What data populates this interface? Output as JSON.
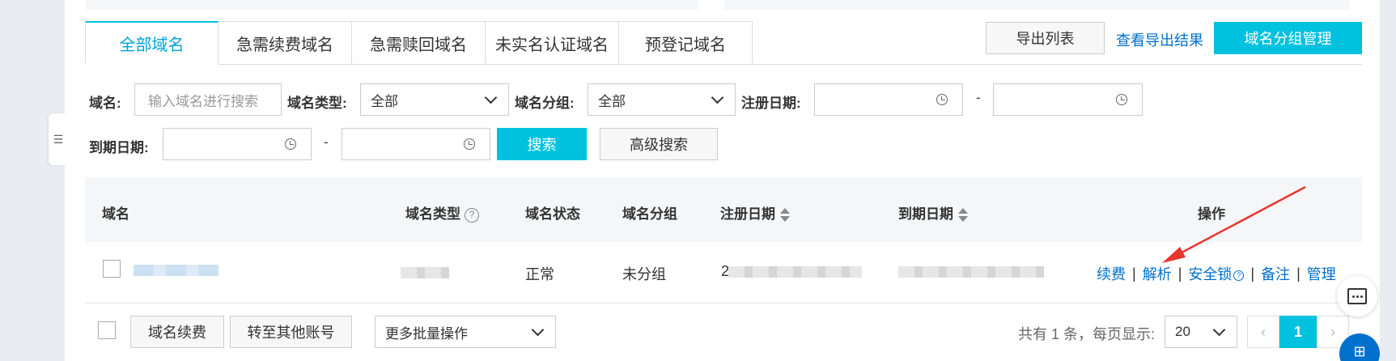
{
  "tabs": [
    "全部域名",
    "急需续费域名",
    "急需赎回域名",
    "未实名认证域名",
    "预登记域名"
  ],
  "header_actions": {
    "export_list": "导出列表",
    "view_export": "查看导出结果",
    "group_manage": "域名分组管理"
  },
  "filters": {
    "domain_label": "域名:",
    "domain_placeholder": "输入域名进行搜索",
    "type_label": "域名类型:",
    "type_value": "全部",
    "group_label": "域名分组:",
    "group_value": "全部",
    "reg_date_label": "注册日期:",
    "expire_date_label": "到期日期:",
    "range_sep": "-",
    "search_button": "搜索",
    "advanced_search": "高级搜索"
  },
  "table": {
    "headers": {
      "domain": "域名",
      "type": "域名类型",
      "status": "域名状态",
      "group": "域名分组",
      "reg_date": "注册日期",
      "expire_date": "到期日期",
      "actions": "操作"
    },
    "rows": [
      {
        "status": "正常",
        "group": "未分组",
        "reg_prefix": "2"
      }
    ],
    "actions": [
      "续费",
      "解析",
      "安全锁",
      "备注",
      "管理"
    ],
    "help_glyph": "?",
    "action_sep": "|"
  },
  "footer": {
    "renew": "域名续费",
    "transfer": "转至其他账号",
    "batch_ops": "更多批量操作",
    "total_text": "共有 1 条，每页显示:",
    "page_size": "20",
    "prev": "‹",
    "current_page": "1",
    "next": "›"
  },
  "colors": {
    "accent": "#00c1de",
    "link": "#0070cc",
    "annotation_arrow": "#e8352e"
  },
  "icons": {
    "left_tab": "list-icon",
    "float_1": "chat-icon",
    "float_2": "apps-icon",
    "float_2_glyph": "⊞"
  }
}
